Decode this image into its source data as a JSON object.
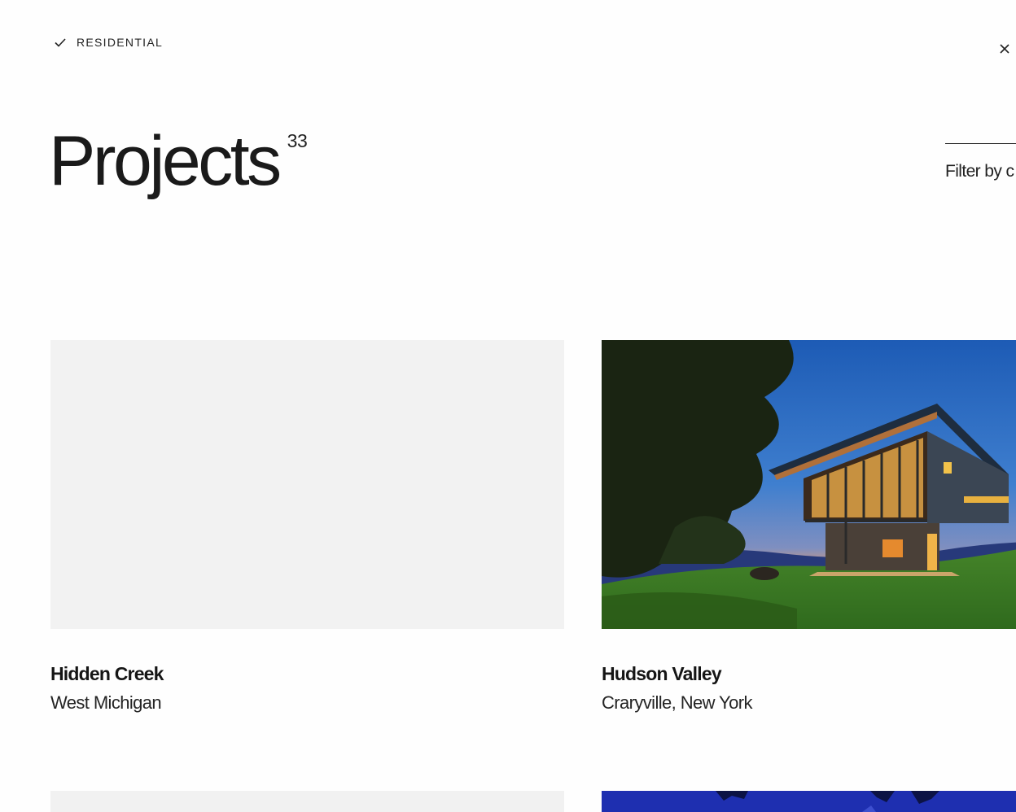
{
  "filter": {
    "active_label": "RESIDENTIAL",
    "select_label": "Filter by c"
  },
  "header": {
    "title": "Projects",
    "count": "33"
  },
  "projects": [
    {
      "name": "Hidden Creek",
      "location": "West Michigan"
    },
    {
      "name": "Hudson Valley",
      "location": "Craryville, New York"
    }
  ],
  "colors": {
    "text": "#1b1b1b",
    "placeholder": "#f2f2f2",
    "background": "#fefefe"
  },
  "icons": {
    "filter_check": "check-icon",
    "close": "close-icon"
  }
}
